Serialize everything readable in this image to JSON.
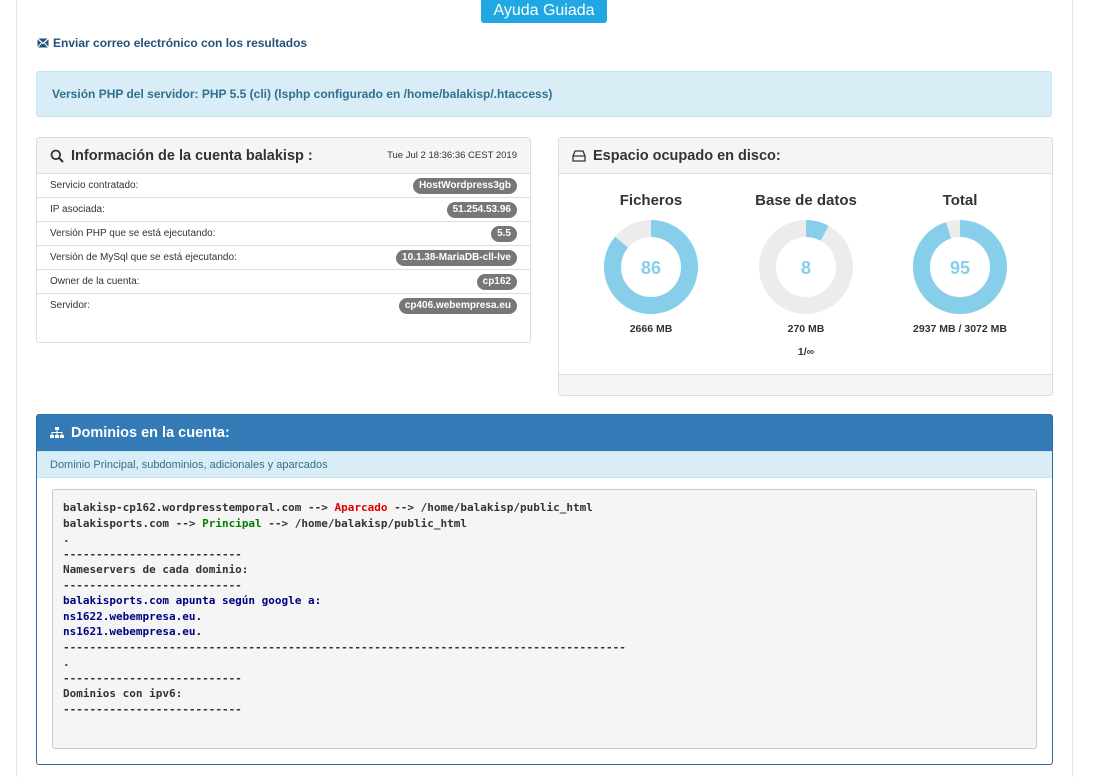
{
  "header": {
    "help_button": "Ayuda Guiada",
    "email_link": "Enviar correo electrónico con los resultados"
  },
  "php_alert": "Versión PHP del servidor: PHP 5.5 (cli) (lsphp configurado en /home/balakisp/.htaccess)",
  "account": {
    "title": "Información de la cuenta balakisp :",
    "date": "Tue Jul 2 18:36:36 CEST 2019",
    "rows": [
      {
        "label": "Servicio contratado:",
        "value": "HostWordpress3gb"
      },
      {
        "label": "IP asociada:",
        "value": "51.254.53.96"
      },
      {
        "label": "Versión PHP que se está ejecutando:",
        "value": "5.5"
      },
      {
        "label": "Versión de MySql que se está ejecutando:",
        "value": "10.1.38-MariaDB-cll-lve"
      },
      {
        "label": "Owner de la cuenta:",
        "value": "cp162"
      },
      {
        "label": "Servidor:",
        "value": "cp406.webempresa.eu"
      }
    ]
  },
  "disk": {
    "title": "Espacio ocupado en disco:",
    "files": {
      "label": "Ficheros",
      "percent": 86,
      "size": "2666 MB"
    },
    "database": {
      "label": "Base de datos",
      "percent": 8,
      "size": "270 MB",
      "count": "1/∞"
    },
    "total": {
      "label": "Total",
      "percent": 95,
      "size": "2937 MB / 3072 MB"
    }
  },
  "domains": {
    "title": "Dominios en la cuenta:",
    "subtitle": "Dominio Principal, subdominios, adicionales y aparcados",
    "lines": [
      {
        "a": "balakisp-cp162.wordpresstemporal.com --> ",
        "tag": "Aparcado",
        "tag_class": "red",
        "b": " --> /home/balakisp/public_html"
      },
      {
        "a": "balakisports.com --> ",
        "tag": "Principal",
        "tag_class": "green",
        "b": " --> /home/balakisp/public_html"
      },
      {
        "a": "."
      },
      {
        "a": "---------------------------"
      },
      {
        "a": "Nameservers de cada dominio:"
      },
      {
        "a": "---------------------------"
      },
      {
        "a": "balakisports.com apunta según google a:",
        "cls": "navy"
      },
      {
        "a": "ns1622.webempresa.eu.",
        "cls": "navy"
      },
      {
        "a": "ns1621.webempresa.eu.",
        "cls": "navy"
      },
      {
        "a": "-------------------------------------------------------------------------------------"
      },
      {
        "a": "."
      },
      {
        "a": "---------------------------"
      },
      {
        "a": "Dominios con ipv6:"
      },
      {
        "a": "---------------------------"
      }
    ]
  },
  "colors": {
    "donut_fill": "#87ceeb",
    "donut_track": "#ececec",
    "donut_text": "#87ceeb",
    "primary": "#337ab7",
    "help_button": "#21a8e3"
  }
}
